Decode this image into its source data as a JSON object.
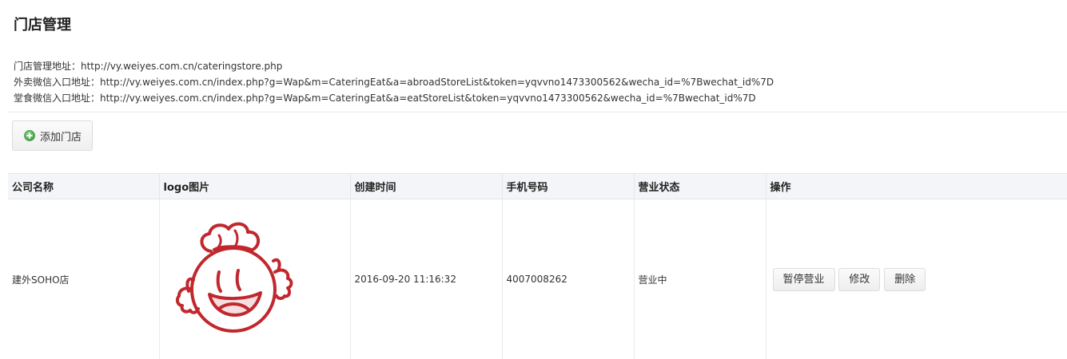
{
  "page": {
    "title": "门店管理"
  },
  "addresses": {
    "store_mgmt": "门店管理地址：http://vy.weiyes.com.cn/cateringstore.php",
    "takeout_wechat": "外卖微信入口地址：http://vy.weiyes.com.cn/index.php?g=Wap&m=CateringEat&a=abroadStoreList&token=yqvvno1473300562&wecha_id=%7Bwechat_id%7D",
    "dinein_wechat": "堂食微信入口地址：http://vy.weiyes.com.cn/index.php?g=Wap&m=CateringEat&a=eatStoreList&token=yqvvno1473300562&wecha_id=%7Bwechat_id%7D"
  },
  "toolbar": {
    "add_store_label": "添加门店",
    "add_icon": "plus-circle-icon",
    "add_icon_color": "#5cb85c"
  },
  "table": {
    "headers": [
      "公司名称",
      "logo图片",
      "创建时间",
      "手机号码",
      "营业状态",
      "操作"
    ],
    "rows": [
      {
        "company": "建外SOHO店",
        "logo": "chef-mascot-logo",
        "created": "2016-09-20 11:16:32",
        "phone": "4007008262",
        "status": "营业中",
        "actions": {
          "pause": "暂停营业",
          "edit": "修改",
          "delete": "删除"
        }
      }
    ]
  },
  "colors": {
    "logo_red": "#c0282d",
    "header_bg": "#f4f5f8"
  }
}
